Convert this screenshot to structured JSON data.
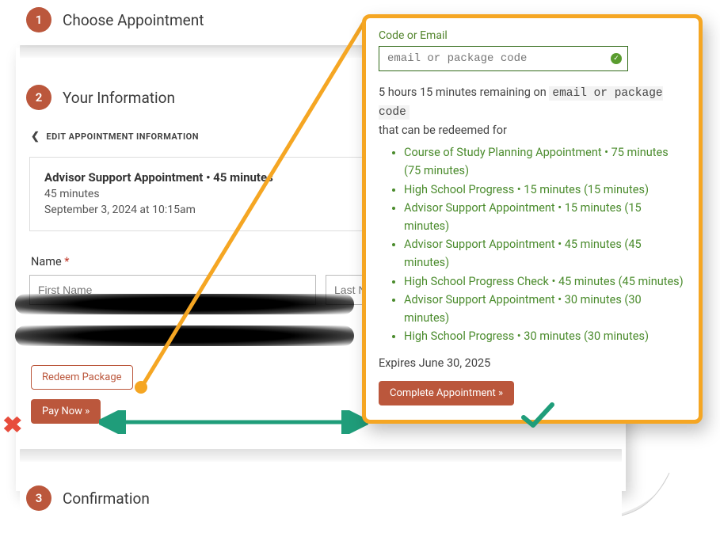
{
  "steps": {
    "s1": {
      "num": "1",
      "title": "Choose Appointment"
    },
    "s2": {
      "num": "2",
      "title": "Your Information"
    },
    "s3": {
      "num": "3",
      "title": "Confirmation"
    }
  },
  "editLink": "EDIT APPOINTMENT INFORMATION",
  "appointment": {
    "title": "Advisor Support Appointment • 45 minutes",
    "duration": "45 minutes",
    "datetime": "September 3, 2024 at 10:15am"
  },
  "form": {
    "nameLabel": "Name",
    "required": " *",
    "firstPh": "First Name",
    "lastPh": "Last Name"
  },
  "buttons": {
    "redeem": "Redeem Package",
    "payNow": "Pay Now »",
    "complete": "Complete Appointment »"
  },
  "callout": {
    "label": "Code or Email",
    "placeholder": "email or package code",
    "remainPrefix": "5 hours 15 minutes remaining on ",
    "codeText": "email or package code",
    "remainSuffix": "that can be redeemed for",
    "items": [
      "Course of Study Planning Appointment • 75 minutes (75 minutes)",
      "High School Progress • 15 minutes (15 minutes)",
      "Advisor Support Appointment • 15 minutes (15 minutes)",
      "Advisor Support Appointment • 45 minutes (45 minutes)",
      "High School Progress Check • 45 minutes (45 minutes)",
      "Advisor Support Appointment • 30 minutes (30 minutes)",
      "High School Progress • 30 minutes (30 minutes)"
    ],
    "expires": "Expires June 30, 2025"
  }
}
